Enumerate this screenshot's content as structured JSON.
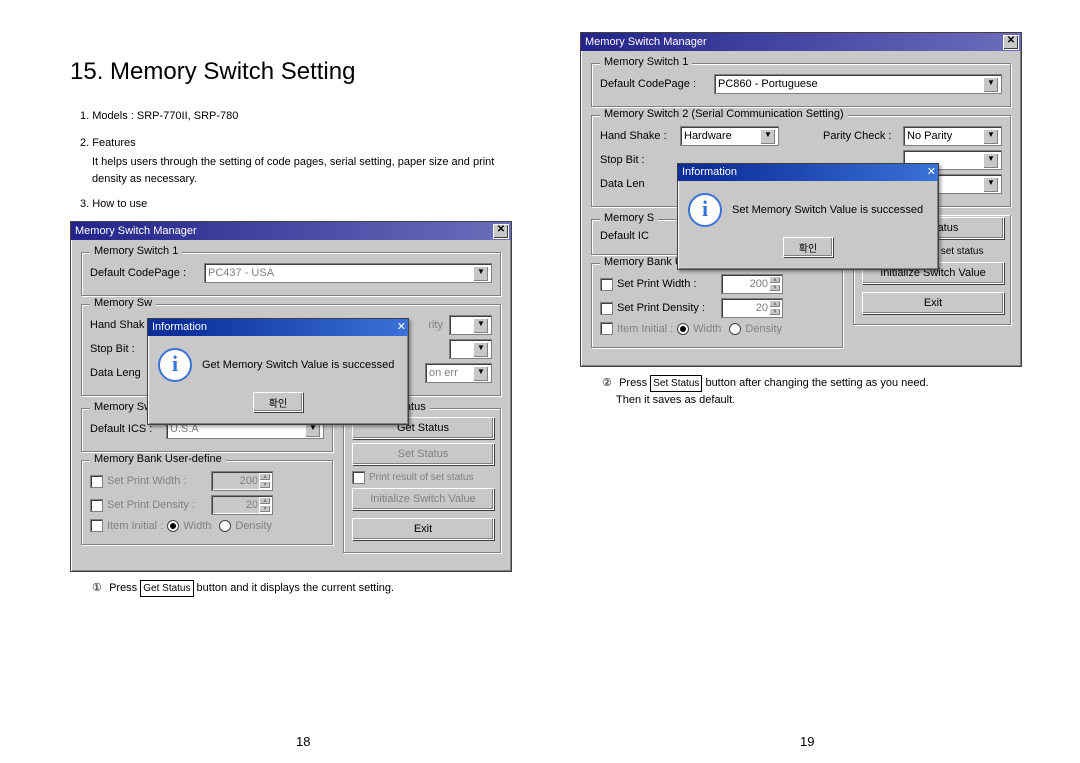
{
  "heading": "15. Memory Switch Setting",
  "intro": {
    "models_label": "1. Models :",
    "models": "SRP-770II, SRP-780",
    "features_label": "2. Features",
    "features": "It helps users through the setting of code pages, serial setting, paper size and print density as necessary.",
    "howto_label": "3. How to use"
  },
  "caption1_num": "①",
  "caption1a": "Press ",
  "caption1_btn": "Get Status",
  "caption1b": " button and it displays the current setting.",
  "caption2_num": "②",
  "caption2a": "Press ",
  "caption2_btn": "Set Status",
  "caption2b": " button after changing the setting as you need.",
  "caption2c": "Then it saves as default.",
  "pagenum_left": "18",
  "pagenum_right": "19",
  "dlg": {
    "title": "Memory Switch Manager",
    "ms1_legend": "Memory Switch 1",
    "codepage_label": "Default CodePage  :",
    "codepage_left": "PC437 - USA",
    "codepage_right": "PC860 - Portuguese",
    "ms2_legend": "Memory Switch 2 (Serial Communication Setting)",
    "handshake_label": "Hand Shake :",
    "handshake_val": "Hardware",
    "parity_label": "Parity Check :",
    "parity_val": "No Parity",
    "stopbit_label": "Stop Bit :",
    "datalen_label": "Data Length :",
    "datalen_short": "Data Leng",
    "onerr": "on err",
    "ms3_legend": "Memory Switch 3",
    "ms3_legend_short": "Memory S",
    "ics_label": "Default ICS :",
    "ics_label_short": "Default IC",
    "ics_val": "U.S.A",
    "ctrl_legend": "Control Status",
    "btn_get": "Get Status",
    "btn_set": "Set Status",
    "btn_init": "Initialize Switch Value",
    "btn_exit": "Exit",
    "bank_legend": "Memory Bank User-define",
    "chk_width": "Set Print Width :",
    "chk_density": "Set Print Density :",
    "val_width": "200",
    "val_density": "20",
    "item_initial": "Item Initial :",
    "rad_width": "Width",
    "rad_density": "Density",
    "chk_print_result": "Print result of set status",
    "s_suffix": "s"
  },
  "msg": {
    "title": "Information",
    "get_text": "Get Memory Switch Value is successed",
    "set_text": "Set Memory Switch Value is successed",
    "ok": "확인"
  }
}
